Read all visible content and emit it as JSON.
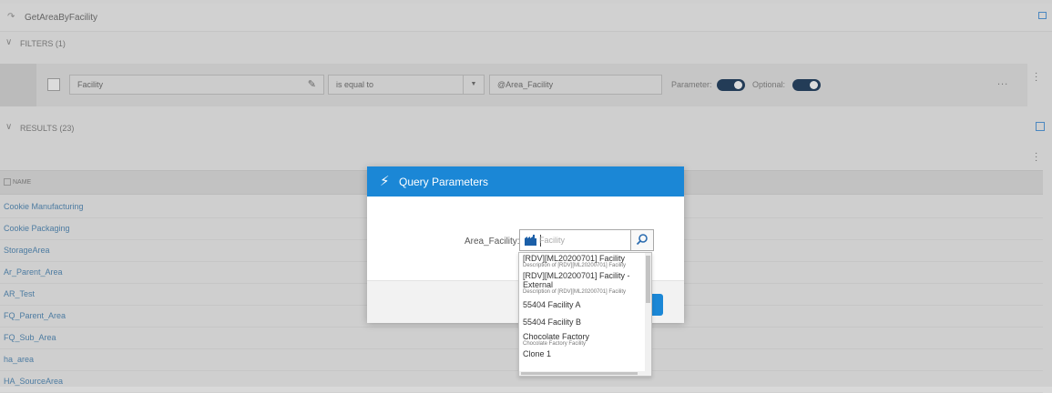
{
  "window": {
    "title": "GetAreaByFacility"
  },
  "filters": {
    "header": "FILTERS (1)",
    "row": {
      "field": "Facility",
      "operator": "is equal to",
      "value": "@Area_Facility",
      "parameter_label": "Parameter:",
      "parameter_on": true,
      "optional_label": "Optional:",
      "optional_on": true,
      "more": "..."
    }
  },
  "results": {
    "header": "RESULTS (23)",
    "column_header": "NAME",
    "rows": [
      "Cookie Manufacturing",
      "Cookie Packaging",
      "StorageArea",
      "Ar_Parent_Area",
      "AR_Test",
      "FQ_Parent_Area",
      "FQ_Sub_Area",
      "ha_area",
      "HA_SourceArea"
    ]
  },
  "modal": {
    "title": "Query Parameters",
    "param_label": "Area_Facility:",
    "lookup": {
      "value": "",
      "placeholder": "Facility"
    },
    "options": [
      {
        "name": "[RDV][ML20200701] Facility",
        "description": "Description of [RDV][ML20200701] Facility"
      },
      {
        "name": "[RDV][ML20200701] Facility - External",
        "description": "Description of [RDV][ML20200701] Facility"
      },
      {
        "name": "55404 Facility A",
        "description": ""
      },
      {
        "name": "55404 Facility B",
        "description": ""
      },
      {
        "name": "Chocolate Factory",
        "description": "Chocolate Factory Facility"
      },
      {
        "name": "Clone 1",
        "description": ""
      }
    ]
  },
  "colors": {
    "accent": "#1b87d6",
    "toggle_on": "#1f3a57",
    "link_text": "#4d7fa8"
  },
  "icons": {
    "title": "query-icon",
    "filters_chevron": "chevron-down-icon",
    "results_chevron": "chevron-down-icon",
    "edit": "pencil-icon",
    "dropdown": "caret-down-icon",
    "modal": "lightning-bolt-icon",
    "lookup_entity": "factory-icon",
    "lookup_search": "magnifier-icon",
    "columns": "columns-icon",
    "more": "vertical-dots-icon"
  }
}
